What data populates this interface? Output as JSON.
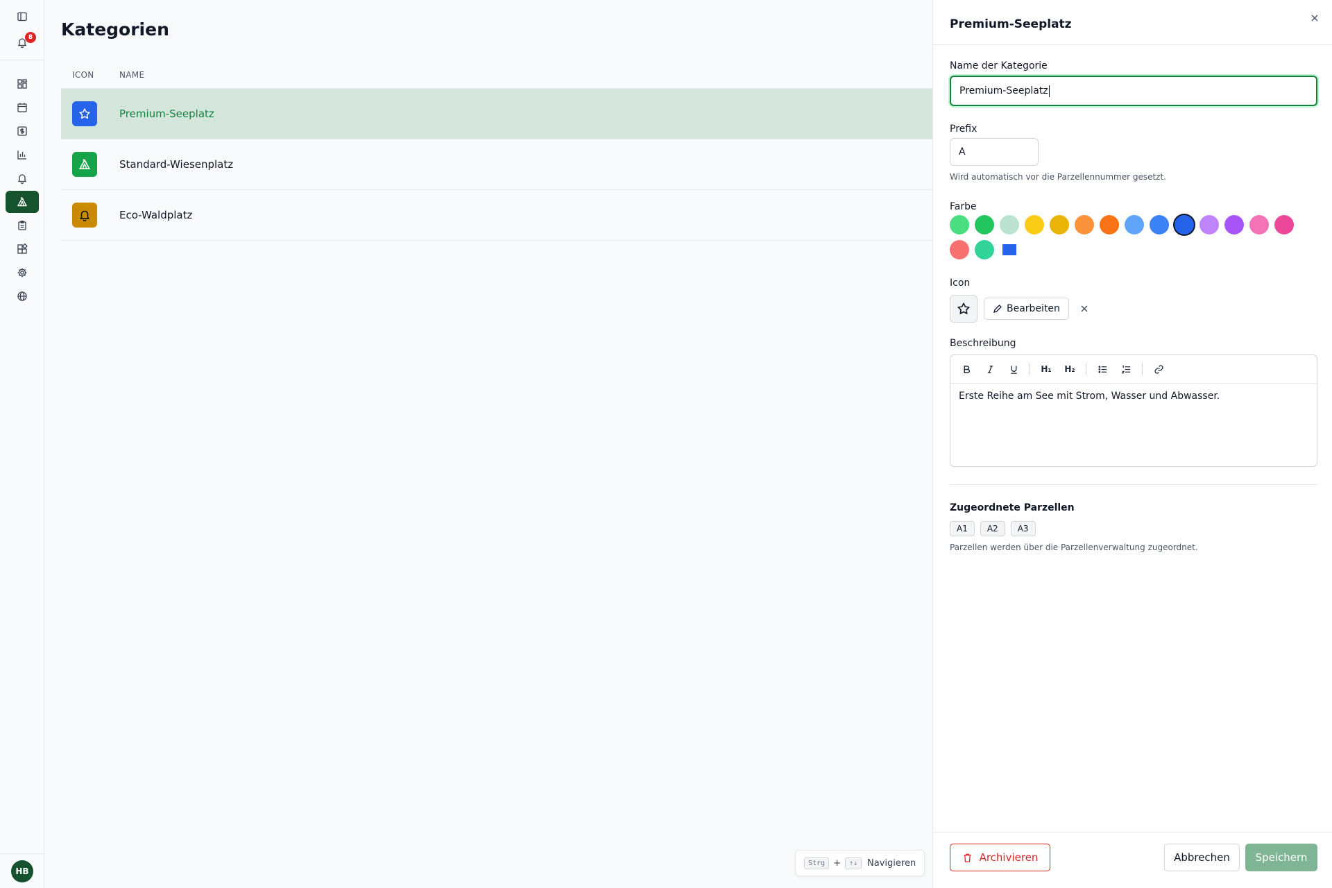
{
  "notifications": {
    "count": "8"
  },
  "user": {
    "initials": "HB"
  },
  "sidebar": {
    "items": [
      {
        "name": "dashboard",
        "icon": "grid-icon"
      },
      {
        "name": "calendar",
        "icon": "calendar-icon"
      },
      {
        "name": "finance",
        "icon": "dollar-icon"
      },
      {
        "name": "reports",
        "icon": "bar-chart-icon"
      },
      {
        "name": "alerts",
        "icon": "bell-icon"
      },
      {
        "name": "categories",
        "icon": "tent-icon",
        "active": true
      },
      {
        "name": "tasks",
        "icon": "clipboard-icon"
      },
      {
        "name": "modules",
        "icon": "blocks-icon"
      },
      {
        "name": "settings",
        "icon": "gear-icon"
      },
      {
        "name": "web",
        "icon": "globe-icon"
      }
    ]
  },
  "main": {
    "title": "Kategorien",
    "columns": {
      "icon": "ICON",
      "name": "NAME"
    },
    "rows": [
      {
        "name": "Premium-Seeplatz",
        "icon": "star-icon",
        "color": "#2563eb",
        "selected": true
      },
      {
        "name": "Standard-Wiesenplatz",
        "icon": "tent-icon",
        "color": "#16a34a"
      },
      {
        "name": "Eco-Waldplatz",
        "icon": "bell-icon",
        "color": "#ca8a04"
      }
    ],
    "shortcut": {
      "key1": "Strg",
      "plus": "+",
      "key2": "↑↓",
      "label": "Navigieren"
    }
  },
  "panel": {
    "title": "Premium-Seeplatz",
    "name_label": "Name der Kategorie",
    "name_value": "Premium-Seeplatz",
    "prefix_label": "Prefix",
    "prefix_value": "A",
    "prefix_help": "Wird automatisch vor die Parzellennummer gesetzt.",
    "color_label": "Farbe",
    "colors": [
      "#4ade80",
      "#22c55e",
      "#bbe3cf",
      "#facc15",
      "#eab308",
      "#fb923c",
      "#f97316",
      "#60a5fa",
      "#3b82f6",
      "#2563eb",
      "#c084fc",
      "#a855f7",
      "#f472b6",
      "#ec4899",
      "#f87171",
      "#34d399"
    ],
    "selected_color": "#2563eb",
    "custom_color": "#2563eb",
    "icon_label": "Icon",
    "icon_value": "star-icon",
    "edit_label": "Bearbeiten",
    "description_label": "Beschreibung",
    "description_text": "Erste Reihe am See mit Strom, Wasser und Abwasser.",
    "toolbar": {
      "h1": "H₁",
      "h2": "H₂"
    },
    "parcels_title": "Zugeordnete Parzellen",
    "parcels": [
      "A1",
      "A2",
      "A3"
    ],
    "parcels_help": "Parzellen werden über die Parzellenverwaltung zugeordnet.",
    "archive_label": "Archivieren",
    "cancel_label": "Abbrechen",
    "save_label": "Speichern"
  }
}
